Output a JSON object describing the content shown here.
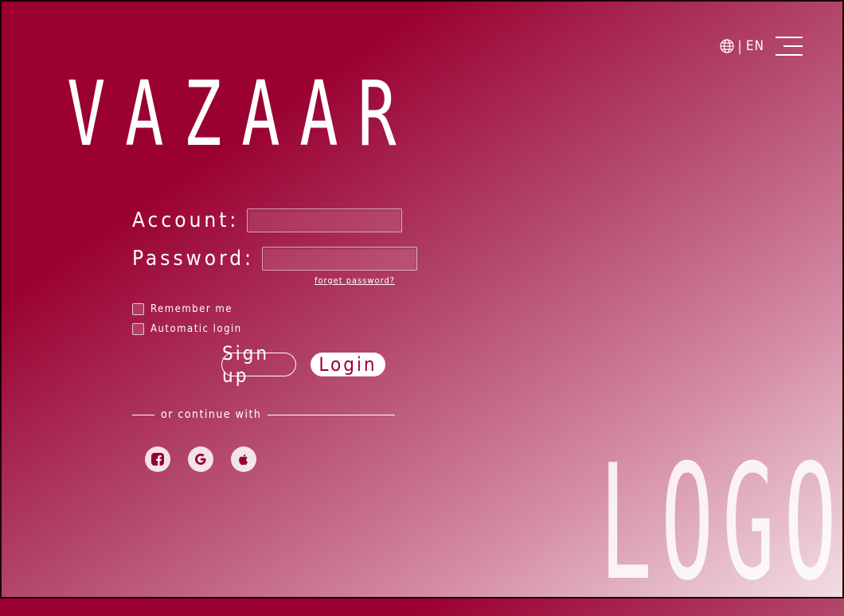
{
  "header": {
    "language": "EN",
    "separator": "|",
    "icons": {
      "language": "globe-icon",
      "menu": "hamburger-menu-icon"
    }
  },
  "brand": {
    "name": "VAZAAR"
  },
  "form": {
    "account_label": "Account:",
    "account_value": "",
    "password_label": "Password:",
    "password_value": "",
    "forgot_label": "forget password?",
    "remember_label": "Remember me",
    "auto_login_label": "Automatic login",
    "signup_label": "Sign up",
    "login_label": "Login"
  },
  "divider": {
    "text": "or continue with"
  },
  "socials": [
    {
      "name": "facebook",
      "icon": "facebook-icon"
    },
    {
      "name": "google",
      "icon": "google-icon"
    },
    {
      "name": "apple",
      "icon": "apple-icon"
    }
  ],
  "footer": {
    "logo_text": "LOGO"
  },
  "colors": {
    "primary": "#9a0030",
    "gradient_end": "#f2dee4",
    "social_icon": "#9a0030"
  }
}
